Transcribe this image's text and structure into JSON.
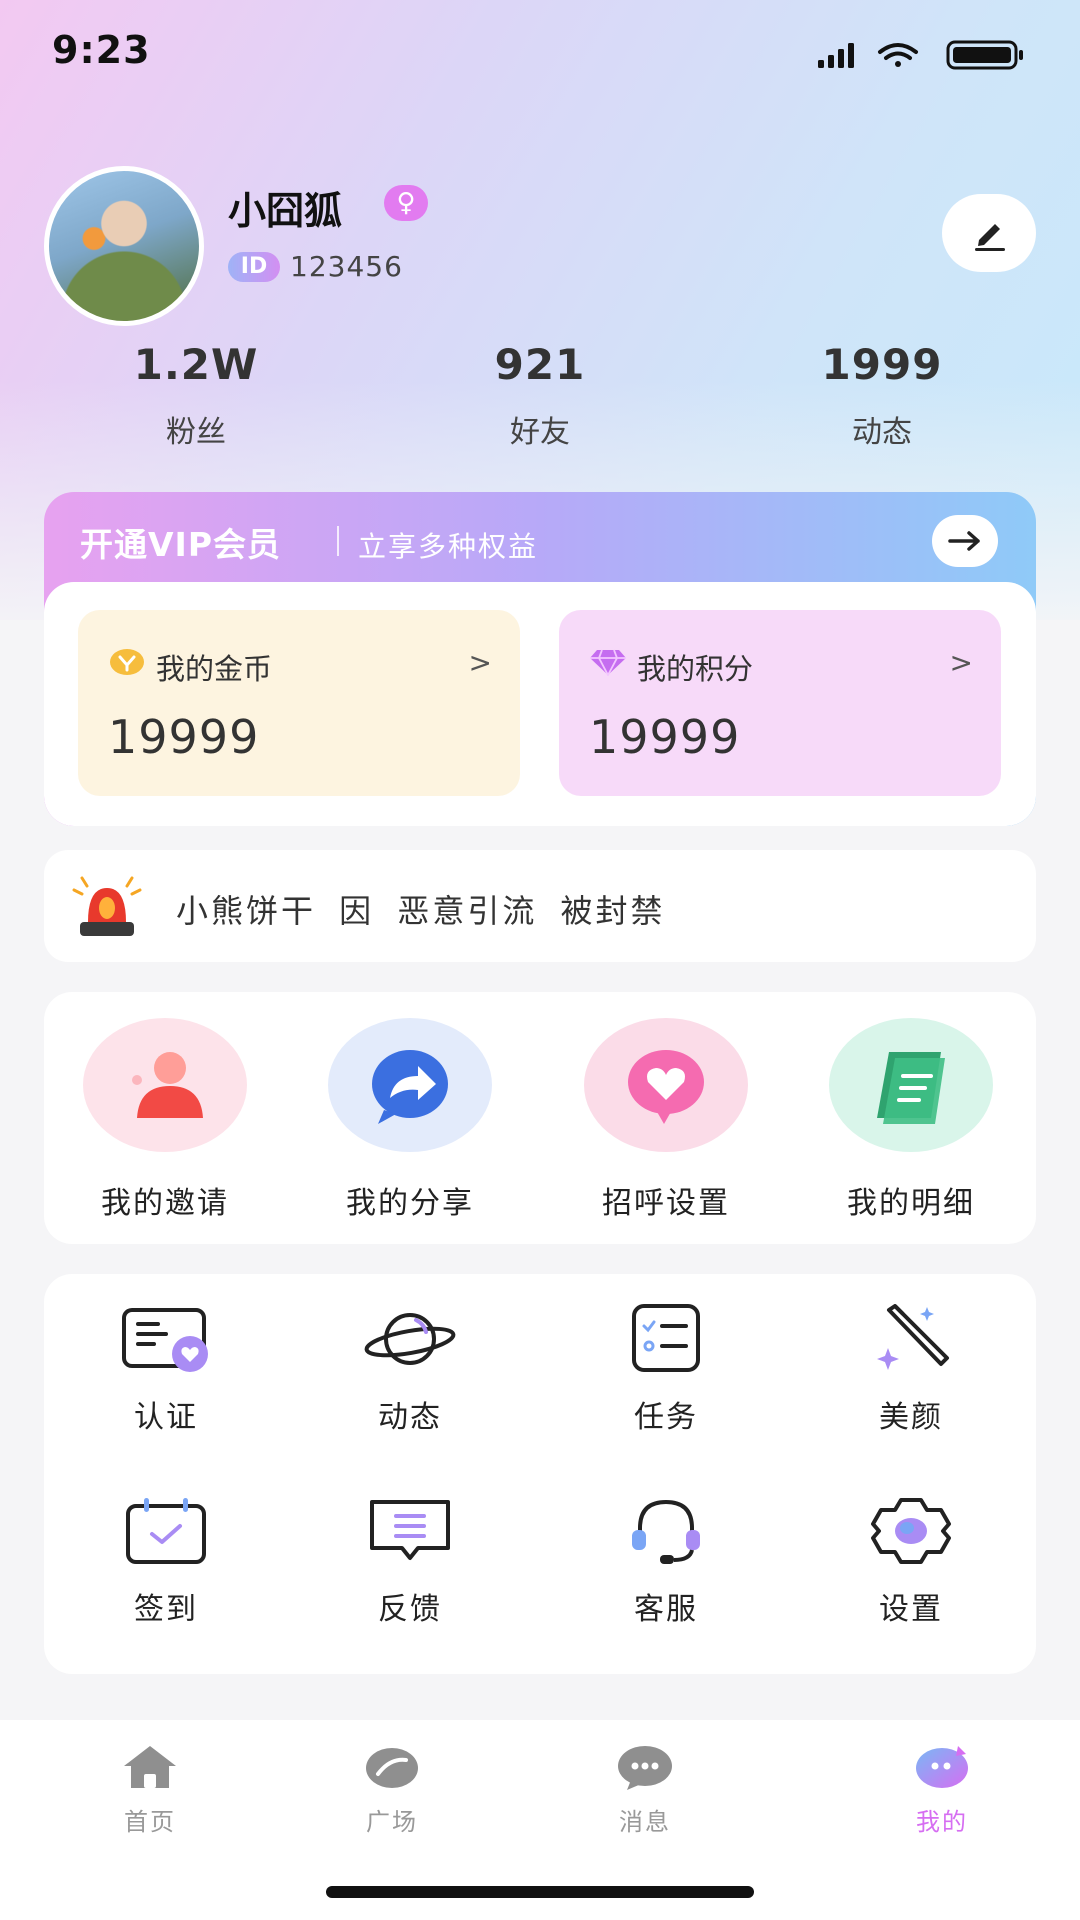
{
  "status_bar": {
    "time": "9:23"
  },
  "profile": {
    "username": "小囧狐",
    "gender_symbol": "♀",
    "id_label": "ID",
    "id_value": "123456"
  },
  "stats": [
    {
      "value": "1.2W",
      "label": "粉丝"
    },
    {
      "value": "921",
      "label": "好友"
    },
    {
      "value": "1999",
      "label": "动态"
    }
  ],
  "vip": {
    "title": "开通VIP会员",
    "subtitle": "立享多种权益",
    "coins": {
      "label": "我的金币",
      "value": "19999",
      "chevron": ">"
    },
    "points": {
      "label": "我的积分",
      "value": "19999",
      "chevron": ">"
    }
  },
  "notice": {
    "text": "小熊饼干 因 恶意引流 被封禁"
  },
  "features": [
    {
      "label": "我的邀请",
      "icon": "invite-icon"
    },
    {
      "label": "我的分享",
      "icon": "share-icon"
    },
    {
      "label": "招呼设置",
      "icon": "greeting-icon"
    },
    {
      "label": "我的明细",
      "icon": "details-icon"
    }
  ],
  "tools": [
    {
      "label": "认证",
      "icon": "verify-icon"
    },
    {
      "label": "动态",
      "icon": "planet-icon"
    },
    {
      "label": "任务",
      "icon": "task-icon"
    },
    {
      "label": "美颜",
      "icon": "beauty-wand-icon"
    },
    {
      "label": "签到",
      "icon": "checkin-calendar-icon"
    },
    {
      "label": "反馈",
      "icon": "feedback-icon"
    },
    {
      "label": "客服",
      "icon": "headset-icon"
    },
    {
      "label": "设置",
      "icon": "gear-icon"
    }
  ],
  "tabs": [
    {
      "label": "首页",
      "icon": "home-icon",
      "active": false
    },
    {
      "label": "广场",
      "icon": "plaza-icon",
      "active": false
    },
    {
      "label": "消息",
      "icon": "message-icon",
      "active": false
    },
    {
      "label": "我的",
      "icon": "profile-tab-icon",
      "active": true
    }
  ],
  "colors": {
    "accent": "#d66ef2",
    "coins_bg": "#fdf4e0",
    "points_bg": "#f7daf9"
  }
}
